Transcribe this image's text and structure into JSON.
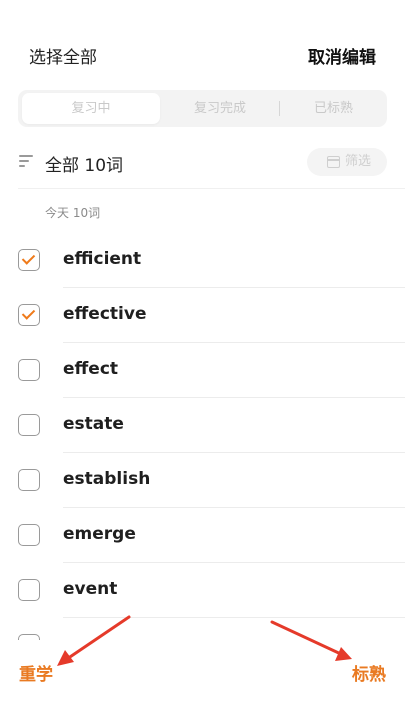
{
  "header": {
    "select_all": "选择全部",
    "cancel_edit": "取消编辑"
  },
  "tabs": [
    {
      "label": "复习中",
      "active": true
    },
    {
      "label": "复习完成",
      "active": false
    },
    {
      "label": "已标熟",
      "active": false
    }
  ],
  "filter_row": {
    "all_label": "全部  10词",
    "filter_button": "筛选"
  },
  "day_group": {
    "label": "今天  10词"
  },
  "words": [
    {
      "word": "efficient",
      "checked": true
    },
    {
      "word": "effective",
      "checked": true
    },
    {
      "word": "effect",
      "checked": false
    },
    {
      "word": "estate",
      "checked": false
    },
    {
      "word": "establish",
      "checked": false
    },
    {
      "word": "emerge",
      "checked": false
    },
    {
      "word": "event",
      "checked": false
    }
  ],
  "bottom_bar": {
    "relearn": "重学",
    "mark_known": "标熟"
  },
  "colors": {
    "accent": "#e97a22",
    "annotation_arrow": "#e53a2a"
  }
}
